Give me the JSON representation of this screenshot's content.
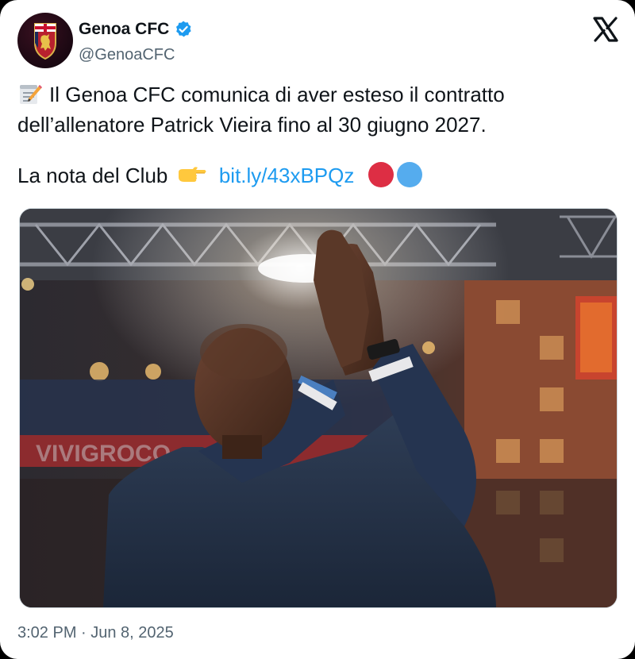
{
  "author": {
    "display_name": "Genoa CFC",
    "handle": "@GenoaCFC",
    "verified": true,
    "avatar_icon": "genoa-crest-icon"
  },
  "platform": {
    "logo_icon": "x-logo-icon"
  },
  "tweet": {
    "line1_emoji": "memo-emoji",
    "line1_text": "Il Genoa CFC comunica di aver esteso il contratto",
    "line2_text": "dell’allenatore Patrick Vieira fino al 30 giugno 2027.",
    "line3_text": "La nota del Club",
    "line3_emoji": "pointing-right-emoji",
    "link_text": "bit.ly/43xBPQz",
    "trailing_emoji": [
      "red-circle",
      "blue-circle"
    ]
  },
  "media": {
    "type": "photo",
    "subject": "coach-applauding-in-stadium"
  },
  "timestamp": "3:02 PM · Jun 8, 2025",
  "colors": {
    "text_primary": "#0f1419",
    "text_secondary": "#536471",
    "link": "#1d9bf0",
    "verified_badge": "#1d9bf0",
    "red_circle": "#dd2e44",
    "blue_circle": "#55acee",
    "background": "#ffffff"
  }
}
